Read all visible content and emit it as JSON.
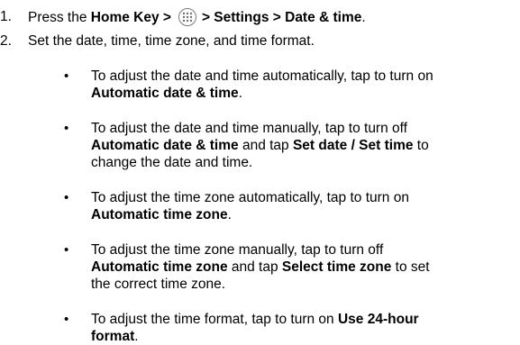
{
  "steps": [
    {
      "number": "1.",
      "parts": {
        "press": "Press the ",
        "home_key": "Home Key >",
        "icon": "apps-icon",
        "path": "> Settings > Date & time",
        "period": "."
      }
    },
    {
      "number": "2.",
      "text": "Set the date, time, time zone, and time format."
    }
  ],
  "bullets": [
    {
      "lines": [
        [
          {
            "t": "To adjust the date and time automatically, tap to turn on",
            "b": false
          }
        ],
        [
          {
            "t": "Automatic date & time",
            "b": true
          },
          {
            "t": ".",
            "b": false
          }
        ]
      ]
    },
    {
      "lines": [
        [
          {
            "t": "To adjust the date and time manually, tap to turn off",
            "b": false
          }
        ],
        [
          {
            "t": "Automatic date & time",
            "b": true
          },
          {
            "t": " and tap ",
            "b": false
          },
          {
            "t": "Set date / Set time",
            "b": true
          },
          {
            "t": " to",
            "b": false
          }
        ],
        [
          {
            "t": "change the date and time.",
            "b": false
          }
        ]
      ]
    },
    {
      "lines": [
        [
          {
            "t": "To adjust the time zone automatically, tap to turn on",
            "b": false
          }
        ],
        [
          {
            "t": "Automatic time zone",
            "b": true
          },
          {
            "t": ".",
            "b": false
          }
        ]
      ]
    },
    {
      "lines": [
        [
          {
            "t": "To adjust the time zone manually, tap to turn off",
            "b": false
          }
        ],
        [
          {
            "t": "Automatic time zone",
            "b": true
          },
          {
            "t": " and tap ",
            "b": false
          },
          {
            "t": "Select time zone",
            "b": true
          },
          {
            "t": " to set",
            "b": false
          }
        ],
        [
          {
            "t": "the correct time zone.",
            "b": false
          }
        ]
      ]
    },
    {
      "lines": [
        [
          {
            "t": "To adjust the time format, tap to turn on ",
            "b": false
          },
          {
            "t": "Use 24-hour",
            "b": true
          }
        ],
        [
          {
            "t": "format",
            "b": true
          },
          {
            "t": ".",
            "b": false
          }
        ]
      ]
    }
  ],
  "bullet_glyph": "•"
}
